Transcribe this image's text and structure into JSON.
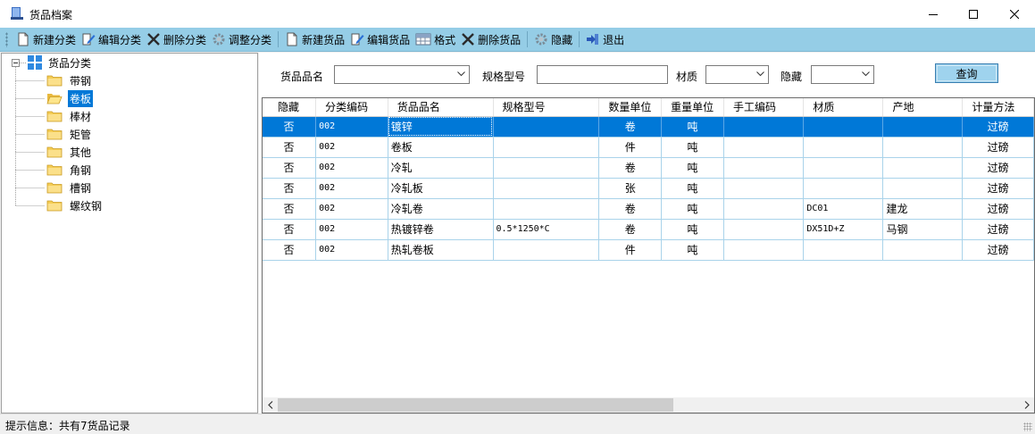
{
  "window": {
    "title": "货品档案"
  },
  "toolbar": {
    "new_category": "新建分类",
    "edit_category": "编辑分类",
    "delete_category": "删除分类",
    "adjust_category": "调整分类",
    "new_goods": "新建货品",
    "edit_goods": "编辑货品",
    "format": "格式",
    "delete_goods": "删除货品",
    "hide": "隐藏",
    "exit": "退出"
  },
  "tree": {
    "root": "货品分类",
    "items": [
      "带钢",
      "卷板",
      "棒材",
      "矩管",
      "其他",
      "角钢",
      "槽钢",
      "螺纹钢"
    ],
    "selected": "卷板"
  },
  "filters": {
    "name_label": "货品品名",
    "name_value": "",
    "spec_label": "规格型号",
    "spec_value": "",
    "material_label": "材质",
    "material_value": "",
    "hidden_label": "隐藏",
    "hidden_value": "",
    "query_button": "查询"
  },
  "grid": {
    "columns": [
      "隐藏",
      "分类编码",
      "货品品名",
      "规格型号",
      "数量单位",
      "重量单位",
      "手工编码",
      "材质",
      "产地",
      "计量方法"
    ],
    "rows": [
      [
        "否",
        "002",
        "镀锌",
        "",
        "卷",
        "吨",
        "",
        "",
        "",
        "过磅"
      ],
      [
        "否",
        "002",
        "卷板",
        "",
        "件",
        "吨",
        "",
        "",
        "",
        "过磅"
      ],
      [
        "否",
        "002",
        "冷轧",
        "",
        "卷",
        "吨",
        "",
        "",
        "",
        "过磅"
      ],
      [
        "否",
        "002",
        "冷轧板",
        "",
        "张",
        "吨",
        "",
        "",
        "",
        "过磅"
      ],
      [
        "否",
        "002",
        "冷轧卷",
        "",
        "卷",
        "吨",
        "",
        "DC01",
        "建龙",
        "过磅"
      ],
      [
        "否",
        "002",
        "热镀锌卷",
        "0.5*1250*C",
        "卷",
        "吨",
        "",
        "DX51D+Z",
        "马钢",
        "过磅"
      ],
      [
        "否",
        "002",
        "热轧卷板",
        "",
        "件",
        "吨",
        "",
        "",
        "",
        "过磅"
      ]
    ],
    "selected_row": 0
  },
  "status": {
    "text": "提示信息：共有7货品记录"
  },
  "colors": {
    "toolbar_bg": "#95cde6",
    "selection": "#0078d7",
    "grid_line": "#a9d3ea"
  }
}
